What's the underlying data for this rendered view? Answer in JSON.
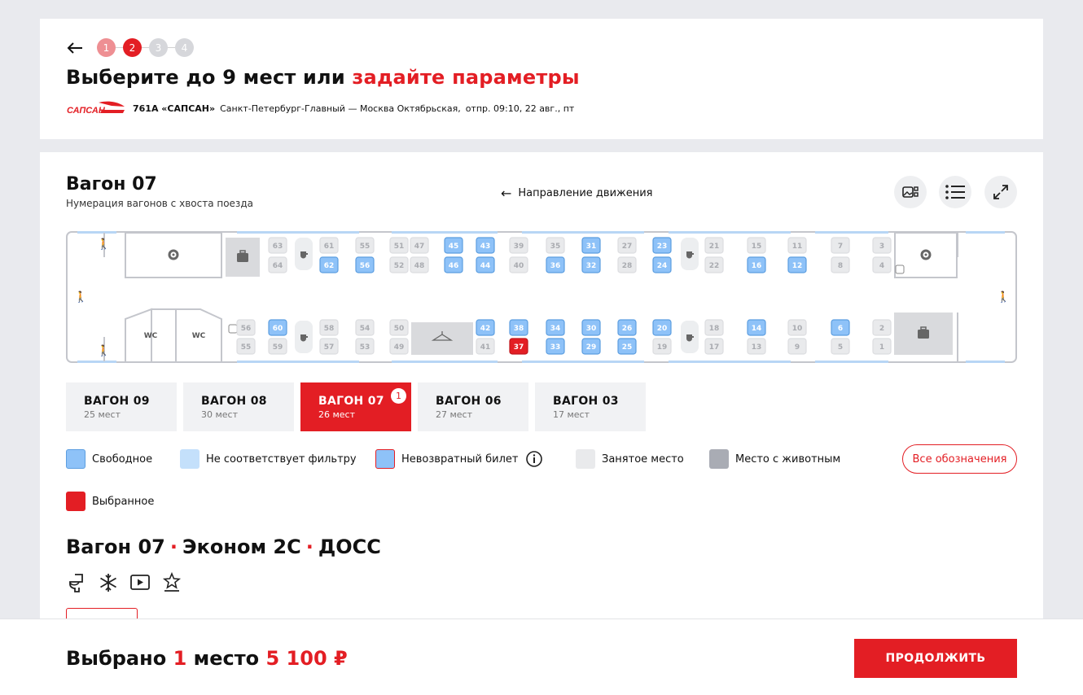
{
  "header": {
    "steps": [
      "1",
      "2",
      "3",
      "4"
    ],
    "title_prefix": "Выберите до 9 мест или ",
    "title_link": "задайте параметры",
    "train_logo_text": "САПСАН",
    "train_name": "761А «САПСАН»",
    "route": "Санкт-Петербург-Главный — Москва Октябрьская,",
    "departure": "отпр. 09:10, 22 авг., пт"
  },
  "wagon": {
    "title": "Вагон 07",
    "subtitle": "Нумерация вагонов с хвоста поезда",
    "direction": "Направление движения",
    "wc_label": "WC"
  },
  "seats": {
    "top": [
      {
        "n": "63",
        "s": "occupied"
      },
      {
        "n": "64",
        "s": "occupied"
      },
      {
        "n": "61",
        "s": "occupied"
      },
      {
        "n": "62",
        "s": "free"
      },
      {
        "n": "55",
        "s": "occupied"
      },
      {
        "n": "56",
        "s": "free"
      },
      {
        "n": "51",
        "s": "occupied"
      },
      {
        "n": "52",
        "s": "occupied"
      },
      {
        "n": "47",
        "s": "occupied"
      },
      {
        "n": "48",
        "s": "occupied"
      },
      {
        "n": "45",
        "s": "free"
      },
      {
        "n": "46",
        "s": "free"
      },
      {
        "n": "43",
        "s": "free"
      },
      {
        "n": "44",
        "s": "free"
      },
      {
        "n": "39",
        "s": "occupied"
      },
      {
        "n": "40",
        "s": "occupied"
      },
      {
        "n": "35",
        "s": "occupied"
      },
      {
        "n": "36",
        "s": "free"
      },
      {
        "n": "31",
        "s": "free"
      },
      {
        "n": "32",
        "s": "free"
      },
      {
        "n": "27",
        "s": "occupied"
      },
      {
        "n": "28",
        "s": "occupied"
      },
      {
        "n": "23",
        "s": "free"
      },
      {
        "n": "24",
        "s": "free"
      },
      {
        "n": "21",
        "s": "occupied"
      },
      {
        "n": "22",
        "s": "occupied"
      },
      {
        "n": "15",
        "s": "occupied"
      },
      {
        "n": "16",
        "s": "free"
      },
      {
        "n": "11",
        "s": "occupied"
      },
      {
        "n": "12",
        "s": "free"
      },
      {
        "n": "7",
        "s": "occupied"
      },
      {
        "n": "8",
        "s": "occupied"
      },
      {
        "n": "3",
        "s": "occupied"
      },
      {
        "n": "4",
        "s": "occupied"
      }
    ],
    "bottom": [
      {
        "n": "56",
        "s": "occupied"
      },
      {
        "n": "55",
        "s": "occupied"
      },
      {
        "n": "60",
        "s": "free"
      },
      {
        "n": "59",
        "s": "occupied"
      },
      {
        "n": "58",
        "s": "occupied"
      },
      {
        "n": "57",
        "s": "occupied"
      },
      {
        "n": "54",
        "s": "occupied"
      },
      {
        "n": "53",
        "s": "occupied"
      },
      {
        "n": "50",
        "s": "occupied"
      },
      {
        "n": "49",
        "s": "occupied"
      },
      {
        "n": "42",
        "s": "free"
      },
      {
        "n": "41",
        "s": "occupied"
      },
      {
        "n": "38",
        "s": "free"
      },
      {
        "n": "37",
        "s": "selected"
      },
      {
        "n": "34",
        "s": "free"
      },
      {
        "n": "33",
        "s": "free"
      },
      {
        "n": "30",
        "s": "free"
      },
      {
        "n": "29",
        "s": "free"
      },
      {
        "n": "26",
        "s": "free"
      },
      {
        "n": "25",
        "s": "free"
      },
      {
        "n": "20",
        "s": "free"
      },
      {
        "n": "19",
        "s": "occupied"
      },
      {
        "n": "18",
        "s": "occupied"
      },
      {
        "n": "17",
        "s": "occupied"
      },
      {
        "n": "14",
        "s": "free"
      },
      {
        "n": "13",
        "s": "occupied"
      },
      {
        "n": "10",
        "s": "occupied"
      },
      {
        "n": "9",
        "s": "occupied"
      },
      {
        "n": "6",
        "s": "free"
      },
      {
        "n": "5",
        "s": "occupied"
      },
      {
        "n": "2",
        "s": "occupied"
      },
      {
        "n": "1",
        "s": "occupied"
      }
    ]
  },
  "wagon_tabs": [
    {
      "title": "ВАГОН 09",
      "sub": "25 мест"
    },
    {
      "title": "ВАГОН 08",
      "sub": "30 мест"
    },
    {
      "title": "ВАГОН 07",
      "sub": "26 мест",
      "badge": "1"
    },
    {
      "title": "ВАГОН 06",
      "sub": "27 мест"
    },
    {
      "title": "ВАГОН 03",
      "sub": "17 мест"
    }
  ],
  "legend": {
    "free": "Свободное",
    "filter": "Не соответствует фильтру",
    "nonrefund": "Невозвратный билет",
    "occupied": "Занятое место",
    "pet": "Место с животным",
    "selected": "Выбранное",
    "all_button": "Все обозначения"
  },
  "colors": {
    "accent": "#e31e24",
    "free": "#8ec2f8",
    "filter": "#c4e0fb",
    "occupied": "#e9eaec",
    "pet": "#a9acb4"
  },
  "section": {
    "title_1": "Вагон 07",
    "sep": "·",
    "title_2": "Эконом 2С",
    "title_3": "ДОСС",
    "amenities": [
      "toilet-icon",
      "air-conditioning-icon",
      "video-icon",
      "comfort-icon"
    ]
  },
  "footer": {
    "prefix": "Выбрано ",
    "count": "1",
    "mid": " место ",
    "price": "5 100 ₽",
    "button": "ПРОДОЛЖИТЬ"
  }
}
